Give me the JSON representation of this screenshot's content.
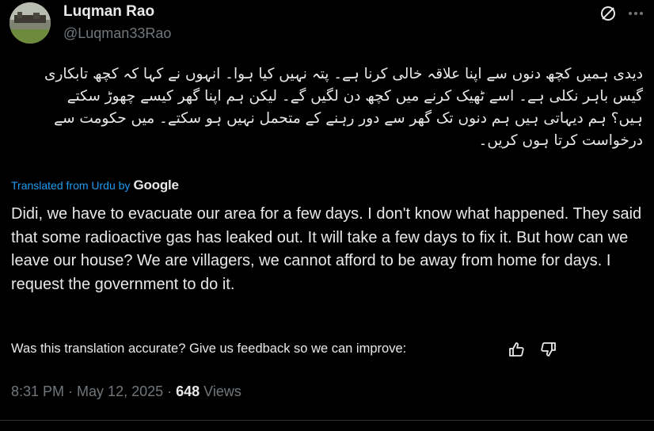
{
  "author": {
    "display_name": "Luqman Rao",
    "handle": "@Luqman33Rao"
  },
  "tweet": {
    "original_text": "دیدی ہمیں کچھ دنوں سے اپنا علاقہ خالی کرنا ہے۔ پتہ نہیں کیا ہوا۔ انہوں نے کہا کہ کچھ تابکاری گیس باہر نکلی ہے۔ اسے ٹھیک کرنے میں کچھ دن لگیں گے۔ لیکن ہم اپنا گھر کیسے چھوڑ سکتے ہیں؟ ہم دیہاتی ہیں ہم دنوں تک گھر سے دور رہنے کے متحمل نہیں ہو سکتے۔ میں حکومت سے درخواست کرتا ہوں کریں۔",
    "translated_label": "Translated from Urdu by",
    "translator_brand": "Google",
    "translated_text": "Didi, we have to evacuate our area for a few days. I don't know what happened. They said that some radioactive gas has leaked out. It will take a few days to fix it. But how can we leave our house? We are villagers, we cannot afford to be away from home for days. I request the government to do it.",
    "feedback_prompt": "Was this translation accurate? Give us feedback so we can improve:"
  },
  "meta": {
    "time": "8:31 PM",
    "separator": " · ",
    "date": "May 12, 2025",
    "views_count": "648",
    "views_label": " Views"
  },
  "icons": {
    "grok": "grok-icon",
    "more": "more-options-icon",
    "thumb_up": "thumbs-up-icon",
    "thumb_down": "thumbs-down-icon"
  },
  "colors": {
    "background": "#000000",
    "text": "#e7e9ea",
    "muted": "#71767b",
    "link": "#1d9bf0"
  }
}
